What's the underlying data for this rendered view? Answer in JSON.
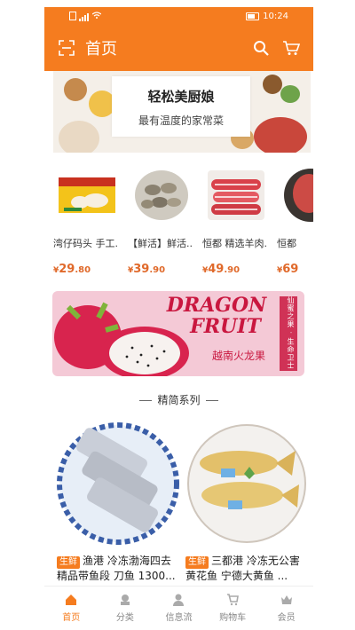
{
  "status_bar": {
    "time": "10:24"
  },
  "header": {
    "title": "首页"
  },
  "banner": {
    "title": "轻松美厨娘",
    "subtitle": "最有温度的家常菜"
  },
  "products": [
    {
      "name": "湾仔码头 手工...",
      "price_symbol": "¥",
      "price_int": "29",
      "price_dec": ".80"
    },
    {
      "name": "【鲜活】鲜活...",
      "price_symbol": "¥",
      "price_int": "39",
      "price_dec": ".90"
    },
    {
      "name": "恒都 精选羊肉...",
      "price_symbol": "¥",
      "price_int": "49",
      "price_dec": ".90"
    },
    {
      "name": "恒都",
      "price_symbol": "¥",
      "price_int": "69",
      "price_dec": ""
    }
  ],
  "promo": {
    "title_line1": "DRAGON",
    "title_line2": "FRUIT",
    "subtitle": "越南火龙果",
    "vertical_text": "仙蜜之果 · 生命卫士"
  },
  "section": {
    "title": "精简系列"
  },
  "featured": [
    {
      "tag": "生鲜",
      "text": "渔港 冷冻渤海四去精品带鱼段 刀鱼 1300..."
    },
    {
      "tag": "生鲜",
      "text": "三都港 冷冻无公害黄花鱼 宁德大黄鱼 ..."
    }
  ],
  "bottom_nav": [
    {
      "label": "首页",
      "icon": "home-icon"
    },
    {
      "label": "分类",
      "icon": "category-icon"
    },
    {
      "label": "信息流",
      "icon": "user-icon"
    },
    {
      "label": "购物车",
      "icon": "cart-icon"
    },
    {
      "label": "会员",
      "icon": "crown-icon"
    }
  ],
  "colors": {
    "accent": "#f57c1f",
    "price": "#e0692a"
  }
}
